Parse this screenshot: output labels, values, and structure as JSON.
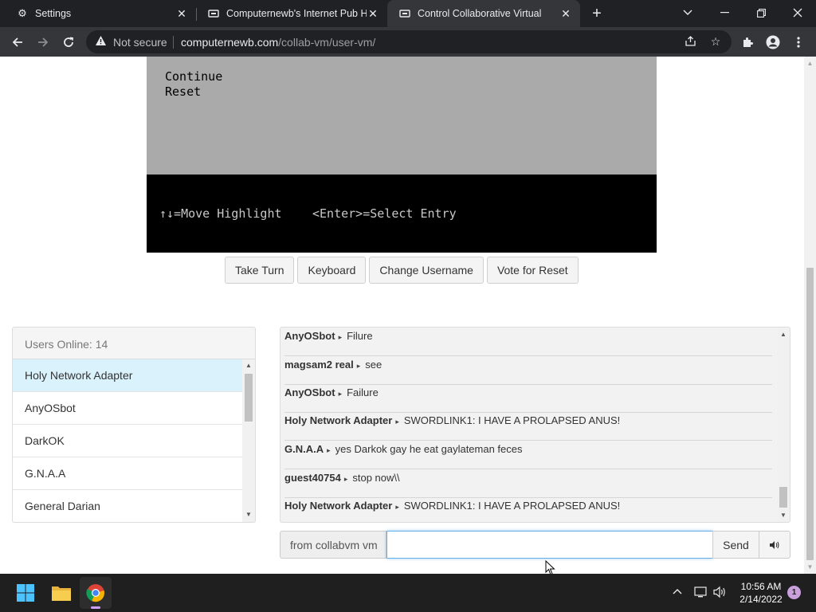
{
  "browser": {
    "tabs": [
      {
        "title": "Settings",
        "icon": "gear-icon"
      },
      {
        "title": "Computernewb's Internet Pub Ho",
        "icon": "site-icon"
      },
      {
        "title": "Control Collaborative Virtual",
        "icon": "site-icon"
      }
    ],
    "security_label": "Not secure",
    "url_host": "computernewb.com",
    "url_path": "/collab-vm/user-vm/"
  },
  "vm": {
    "menu_items": [
      "Continue",
      "Reset"
    ],
    "footer_left": "↑↓=Move Highlight",
    "footer_right": "<Enter>=Select Entry",
    "buttons": {
      "take_turn": "Take Turn",
      "keyboard": "Keyboard",
      "change_username": "Change Username",
      "vote_reset": "Vote for Reset"
    }
  },
  "users": {
    "header": "Users Online: 14",
    "list": [
      "Holy Network Adapter",
      "AnyOSbot",
      "DarkOK",
      "G.N.A.A",
      "General Darian"
    ]
  },
  "chat": {
    "messages": [
      {
        "user": "AnyOSbot",
        "text": "Filure"
      },
      {
        "user": "magsam2 real",
        "text": "see"
      },
      {
        "user": "AnyOSbot",
        "text": "Failure"
      },
      {
        "user": "Holy Network Adapter",
        "text": "SWORDLINK1: I HAVE A PROLAPSED ANUS!"
      },
      {
        "user": "G.N.A.A",
        "text": "yes Darkok gay he eat gaylateman feces"
      },
      {
        "user": "guest40754",
        "text": "stop now\\\\"
      },
      {
        "user": "Holy Network Adapter",
        "text": "SWORDLINK1: I HAVE A PROLAPSED ANUS!"
      }
    ],
    "from_label": "from collabvm vm",
    "input_value": "",
    "send_label": "Send"
  },
  "taskbar": {
    "time": "10:56 AM",
    "date": "2/14/2022",
    "notification_count": "1"
  }
}
